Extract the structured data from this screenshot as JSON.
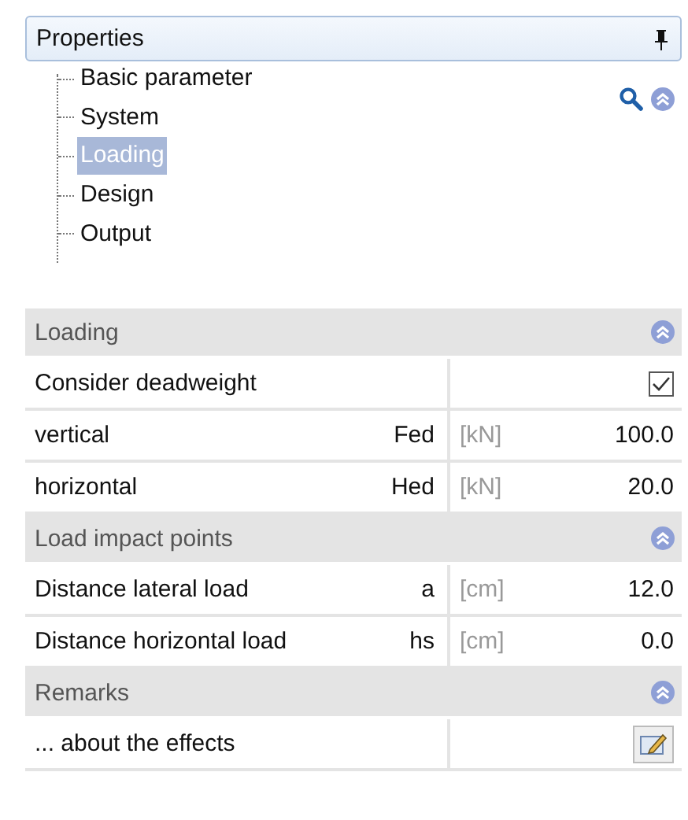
{
  "header": {
    "title": "Properties"
  },
  "tree": [
    {
      "label": "Basic parameter",
      "selected": false
    },
    {
      "label": "System",
      "selected": false
    },
    {
      "label": "Loading",
      "selected": true
    },
    {
      "label": "Design",
      "selected": false
    },
    {
      "label": "Output",
      "selected": false
    }
  ],
  "sections": [
    {
      "title": "Loading",
      "expanded": true,
      "rows": [
        {
          "kind": "checkbox",
          "label": "Consider deadweight",
          "checked": true
        },
        {
          "kind": "value",
          "label": "vertical",
          "symbol": "Fed",
          "unit": "[kN]",
          "value": "100.0"
        },
        {
          "kind": "value",
          "label": "horizontal",
          "symbol": "Hed",
          "unit": "[kN]",
          "value": "20.0"
        }
      ]
    },
    {
      "title": "Load impact points",
      "expanded": true,
      "rows": [
        {
          "kind": "value",
          "label": "Distance lateral load",
          "symbol": "a",
          "unit": "[cm]",
          "value": "12.0"
        },
        {
          "kind": "value",
          "label": "Distance horizontal load",
          "symbol": "hs",
          "unit": "[cm]",
          "value": "0.0"
        }
      ]
    },
    {
      "title": "Remarks",
      "expanded": true,
      "rows": [
        {
          "kind": "edit",
          "label": "... about the effects"
        }
      ]
    }
  ]
}
